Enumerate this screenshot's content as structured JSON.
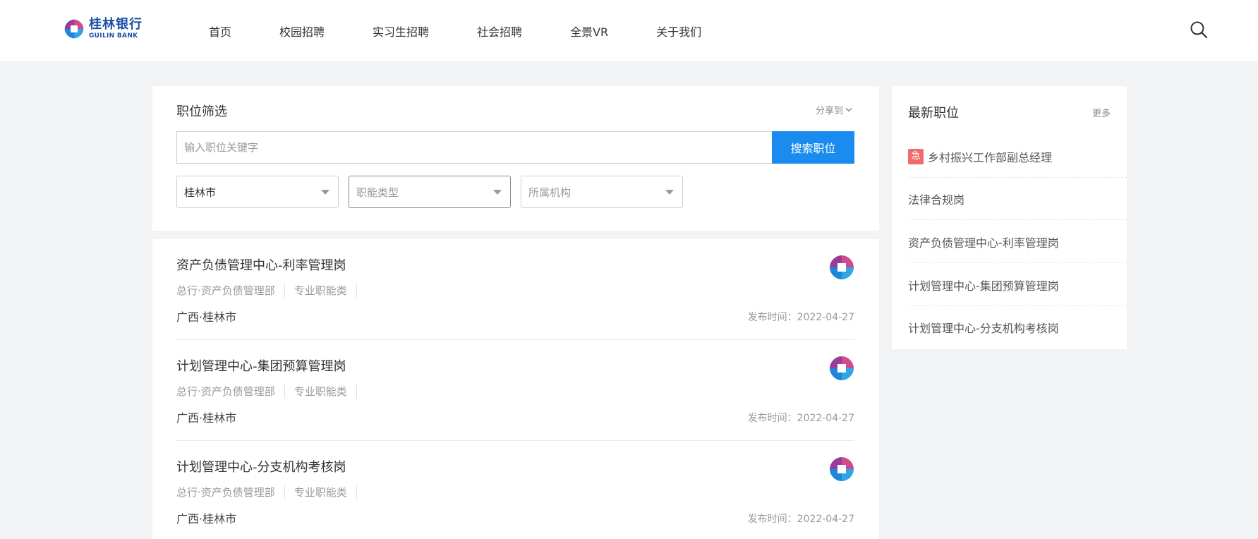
{
  "header": {
    "logo": {
      "cn": "桂林银行",
      "en": "GUILIN BANK"
    },
    "nav": [
      "首页",
      "校园招聘",
      "实习生招聘",
      "社会招聘",
      "全景VR",
      "关于我们"
    ]
  },
  "filter": {
    "title": "职位筛选",
    "share_label": "分享到",
    "search_placeholder": "输入职位关键字",
    "search_button": "搜索职位",
    "selects": {
      "city": "桂林市",
      "function": "职能类型",
      "org": "所属机构"
    }
  },
  "jobs": [
    {
      "title": "资产负债管理中心-利率管理岗",
      "dept": "总行·资产负债管理部",
      "category": "专业职能类",
      "location": "广西·桂林市",
      "date": "发布时间：2022-04-27"
    },
    {
      "title": "计划管理中心-集团预算管理岗",
      "dept": "总行·资产负债管理部",
      "category": "专业职能类",
      "location": "广西·桂林市",
      "date": "发布时间：2022-04-27"
    },
    {
      "title": "计划管理中心-分支机构考核岗",
      "dept": "总行·资产负债管理部",
      "category": "专业职能类",
      "location": "广西·桂林市",
      "date": "发布时间：2022-04-27"
    }
  ],
  "sidebar": {
    "title": "最新职位",
    "more": "更多",
    "urgent_tag": "急",
    "items": [
      "乡村振兴工作部副总经理",
      "法律合规岗",
      "资产负债管理中心-利率管理岗",
      "计划管理中心-集团预算管理岗",
      "计划管理中心-分支机构考核岗"
    ]
  },
  "colors": {
    "primary": "#1a8cf0",
    "urgent": "#f06b6b",
    "logo_blue": "#1b4fa3",
    "logo_magenta": "#c8367f"
  }
}
